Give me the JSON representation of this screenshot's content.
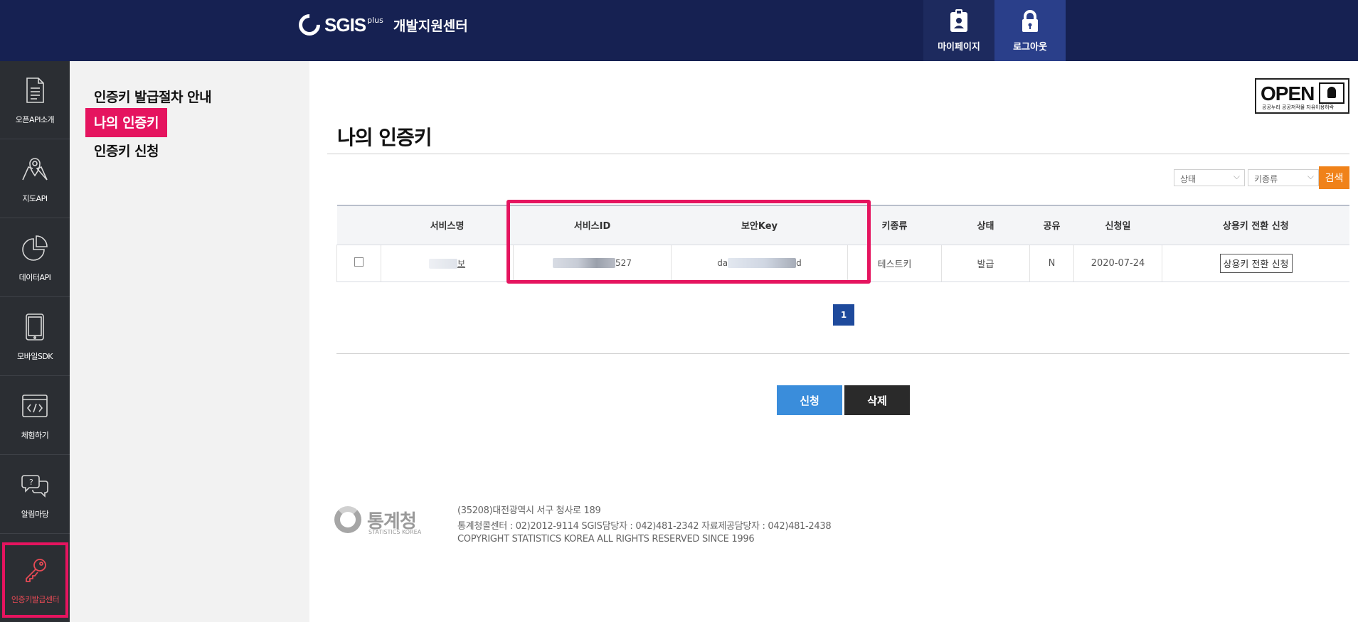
{
  "header": {
    "brand": "SGIS",
    "brand_sup": "plus",
    "subtitle": "개발지원센터",
    "mypage_label": "마이페이지",
    "logout_label": "로그아웃"
  },
  "rail": {
    "items": [
      {
        "label": "오픈API소개",
        "icon": "document-icon"
      },
      {
        "label": "지도API",
        "icon": "map-pin-icon"
      },
      {
        "label": "데이터API",
        "icon": "pie-chart-icon"
      },
      {
        "label": "모바일SDK",
        "icon": "tablet-icon"
      },
      {
        "label": "체험하기",
        "icon": "code-window-icon"
      },
      {
        "label": "알림마당",
        "icon": "chat-bubbles-icon"
      },
      {
        "label": "인증키발급센터",
        "icon": "key-icon",
        "active": true
      }
    ]
  },
  "submenu": {
    "items": [
      {
        "label": "인증키 발급절차 안내"
      },
      {
        "label": "나의 인증키",
        "active": true
      },
      {
        "label": "인증키 신청"
      }
    ]
  },
  "open_badge": {
    "word": "OPEN",
    "caption": "공공누리  공공저작물 자유이용허락"
  },
  "page": {
    "title": "나의 인증키"
  },
  "filters": {
    "status_selected": "상태",
    "kind_selected": "키종류",
    "search_label": "검색"
  },
  "table": {
    "headers": [
      "",
      "서비스명",
      "서비스ID",
      "보안Key",
      "키종류",
      "상태",
      "공유",
      "신청일",
      "상용키 전환 신청"
    ],
    "rows": [
      {
        "service_name": "보",
        "service_id": "527",
        "secure_key_start": "da",
        "secure_key_end": "d",
        "key_type": "테스트키",
        "status": "발급",
        "shared": "N",
        "date": "2020-07-24",
        "convert_label": "상용키 전환 신청"
      }
    ]
  },
  "pagination": {
    "current": "1"
  },
  "actions": {
    "apply_label": "신청",
    "delete_label": "삭제"
  },
  "footer": {
    "org_name": "통계청",
    "org_en": "STATISTICS KOREA",
    "address": "(35208)대전광역시 서구 청사로 189",
    "contact": "통계청콜센터 : 02)2012-9114 SGIS담당자 : 042)481-2342 자료제공담당자 : 042)481-2438",
    "copyright": "COPYRIGHT STATISTICS KOREA ALL RIGHTS RESERVED SINCE 1996"
  },
  "colors": {
    "header_bg": "#162152",
    "rail_bg": "#2b2e33",
    "highlight": "#e5145f",
    "search_button": "#f08219",
    "apply_button": "#3a8ddb",
    "delete_button": "#2a2a2a",
    "page_active": "#1e4a9c"
  }
}
